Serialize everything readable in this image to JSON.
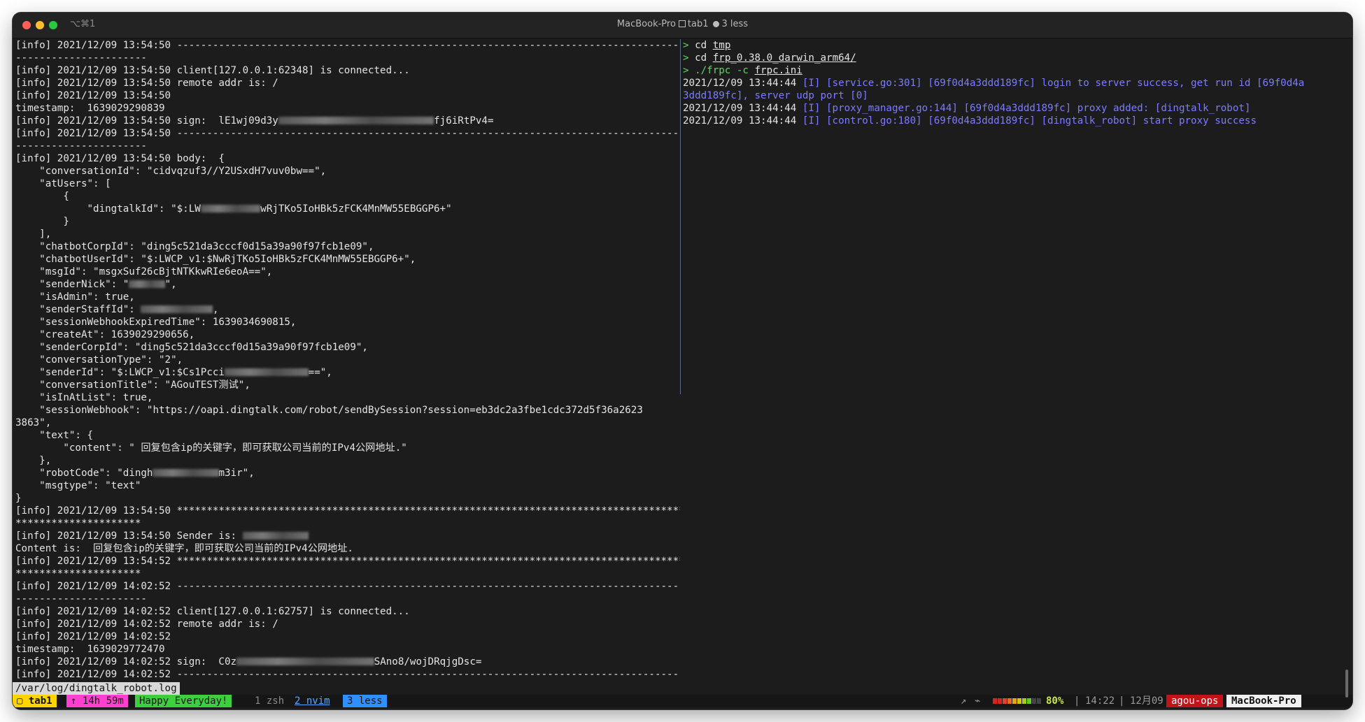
{
  "window": {
    "shortcut": "⌥⌘1",
    "title_host": "MacBook-Pro",
    "title_tab": "tab1",
    "title_less": "3 less"
  },
  "left_pane": {
    "lines": [
      "[info] 2021/12/09 13:54:50 -------------------------------------------------------------------------------------",
      "----------------------",
      "[info] 2021/12/09 13:54:50 client[127.0.0.1:62348] is connected...",
      "[info] 2021/12/09 13:54:50 remote addr is: /",
      "[info] 2021/12/09 13:54:50",
      "timestamp:  1639029290839",
      {
        "before": "[info] 2021/12/09 13:54:50 sign:  lE1wj09d3y",
        "blur_chars": 26,
        "after": "fj6iRtPv4="
      },
      "[info] 2021/12/09 13:54:50 -------------------------------------------------------------------------------------",
      "----------------------",
      "[info] 2021/12/09 13:54:50 body:  {",
      "    \"conversationId\": \"cidvqzuf3//Y2USxdH7vuv0bw==\",",
      "    \"atUsers\": [",
      "        {",
      {
        "before": "            \"dingtalkId\": \"$:LW",
        "blur_chars": 10,
        "after": "wRjTKo5IoHBk5zFCK4MnMW55EBGGP6+\""
      },
      "        }",
      "    ],",
      "    \"chatbotCorpId\": \"ding5c521da3cccf0d15a39a90f97fcb1e09\",",
      "    \"chatbotUserId\": \"$:LWCP_v1:$NwRjTKo5IoHBk5zFCK4MnMW55EBGGP6+\",",
      "    \"msgId\": \"msgxSuf26cBjtNTKkwRIe6eoA==\",",
      {
        "before": "    \"senderNick\": \"",
        "blur_chars": 6,
        "after": "\","
      },
      "    \"isAdmin\": true,",
      {
        "before": "    \"senderStaffId\": ",
        "blur_chars": 12,
        "after": ","
      },
      "    \"sessionWebhookExpiredTime\": 1639034690815,",
      "    \"createAt\": 1639029290656,",
      "    \"senderCorpId\": \"ding5c521da3cccf0d15a39a90f97fcb1e09\",",
      "    \"conversationType\": \"2\",",
      {
        "before": "    \"senderId\": \"$:LWCP_v1:$Cs1Pcci",
        "blur_chars": 14,
        "after": "==\","
      },
      "    \"conversationTitle\": \"AGouTEST测试\",",
      "    \"isInAtList\": true,",
      "    \"sessionWebhook\": \"https://oapi.dingtalk.com/robot/sendBySession?session=eb3dc2a3fbe1cdc372d5f36a2623",
      "3863\",",
      "    \"text\": {",
      "        \"content\": \" 回复包含ip的关键字，即可获取公司当前的IPv4公网地址.\"",
      "    },",
      {
        "before": "    \"robotCode\": \"dingh",
        "blur_chars": 11,
        "after": "m3ir\","
      },
      "    \"msgtype\": \"text\"",
      "}",
      "[info] 2021/12/09 13:54:50 *************************************************************************************",
      "*********************",
      {
        "before": "[info] 2021/12/09 13:54:50 Sender is: ",
        "blur_chars": 11,
        "after": ""
      },
      "Content is:  回复包含ip的关键字，即可获取公司当前的IPv4公网地址.",
      "[info] 2021/12/09 13:54:52 *************************************************************************************",
      "*********************",
      "[info] 2021/12/09 14:02:52 -------------------------------------------------------------------------------------",
      "----------------------",
      "[info] 2021/12/09 14:02:52 client[127.0.0.1:62757] is connected...",
      "[info] 2021/12/09 14:02:52 remote addr is: /",
      "[info] 2021/12/09 14:02:52",
      "timestamp:  1639029772470",
      {
        "before": "[info] 2021/12/09 14:02:52 sign:  C0z",
        "blur_chars": 23,
        "after": "SAno8/wojDRqjgDsc="
      },
      "[info] 2021/12/09 14:02:52 -------------------------------------------------------------------------------------"
    ],
    "file_path": "/var/log/dingtalk_robot.log"
  },
  "right_pane": {
    "commands": [
      {
        "prompt": "> ",
        "cmd": "cd",
        "arg": "tmp"
      },
      {
        "prompt": "> ",
        "cmd": "cd",
        "arg": "frp_0.38.0_darwin_arm64/"
      },
      {
        "prompt": "> ",
        "cmd": "./frpc -c",
        "arg": "frpc.ini"
      }
    ],
    "log_lines": [
      {
        "ts": "2021/12/09 13:44:44 ",
        "msg": "[I] [service.go:301] [69f0d4a3ddd189fc] login to server success, get run id [69f0d4a"
      },
      {
        "ts": "",
        "msg": "3ddd189fc], server udp port [0]"
      },
      {
        "ts": "2021/12/09 13:44:44 ",
        "msg": "[I] [proxy_manager.go:144] [69f0d4a3ddd189fc] proxy added: [dingtalk_robot]"
      },
      {
        "ts": "2021/12/09 13:44:44 ",
        "msg": "[I] [control.go:180] [69f0d4a3ddd189fc] [dingtalk_robot] start proxy success"
      }
    ]
  },
  "statusbar": {
    "tab": "▢ tab1",
    "uptime": "↑ 14h 59m",
    "greeting": "Happy Everyday!",
    "win1": "1 zsh",
    "win2": "2 nvim",
    "win3": "3 less",
    "battery_percent": "80%",
    "time": "14:22",
    "date": "12月09",
    "host_user": "agou-ops",
    "host_machine": "MacBook-Pro"
  },
  "colors": {
    "background": "#1c1c1c",
    "text": "#e4e4e4",
    "prompt": "#5fd75f",
    "log_blue": "#7b7cff",
    "tab_yellow": "#ffd500",
    "uptime_pink": "#ff3fd0",
    "greeting_green": "#3ecf3e",
    "active_window_blue": "#2f8fff",
    "host_red": "#c0131a"
  }
}
